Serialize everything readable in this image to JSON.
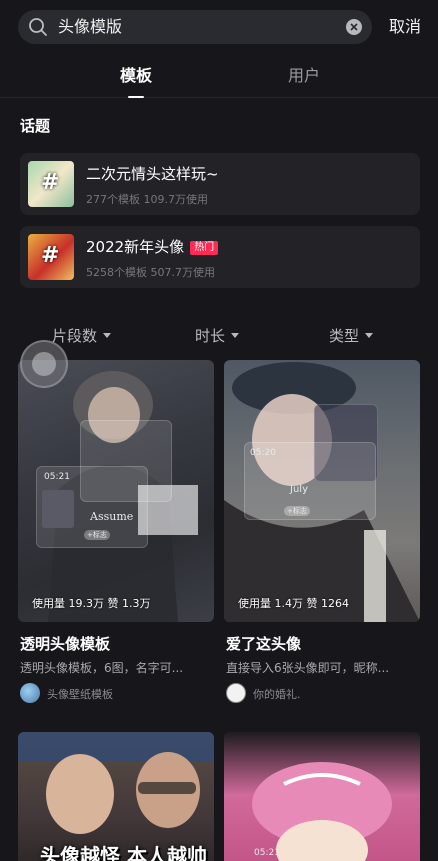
{
  "search": {
    "query": "头像模版",
    "cancel_label": "取消"
  },
  "tabs": [
    {
      "label": "模板",
      "active": true
    },
    {
      "label": "用户",
      "active": false
    }
  ],
  "topics_section": {
    "title": "话题",
    "items": [
      {
        "name": "二次元情头这样玩~",
        "meta": "277个模板 109.7万使用",
        "badge": ""
      },
      {
        "name": "2022新年头像",
        "meta": "5258个模板 507.7万使用",
        "badge": "热门"
      }
    ]
  },
  "filters": [
    {
      "label": "片段数"
    },
    {
      "label": "时长"
    },
    {
      "label": "类型"
    }
  ],
  "templates": [
    {
      "title": "透明头像模板",
      "description": "透明头像模板，6图，名字可...",
      "usage": "使用量 19.3万 赞 1.3万",
      "author": "头像壁纸模板",
      "overlay_time": "05:21",
      "overlay_song": "Assume",
      "overlay_tag": "+标志"
    },
    {
      "title": "爱了这头像",
      "description": "直接导入6张头像即可，昵称...",
      "usage": "使用量 1.4万 赞 1264",
      "author": "你的婚礼.",
      "overlay_time": "05:20",
      "overlay_song": "July",
      "overlay_tag": "+标志"
    },
    {
      "caption": "头像越怪 本人越帅"
    },
    {
      "overlay_time": "05:21"
    }
  ],
  "colors": {
    "background": "#17171b",
    "card": "#222227",
    "hot": "#fe2c55"
  },
  "icons": [
    "search-icon",
    "clear-icon",
    "caret-down-icon",
    "hashtag-icon"
  ]
}
